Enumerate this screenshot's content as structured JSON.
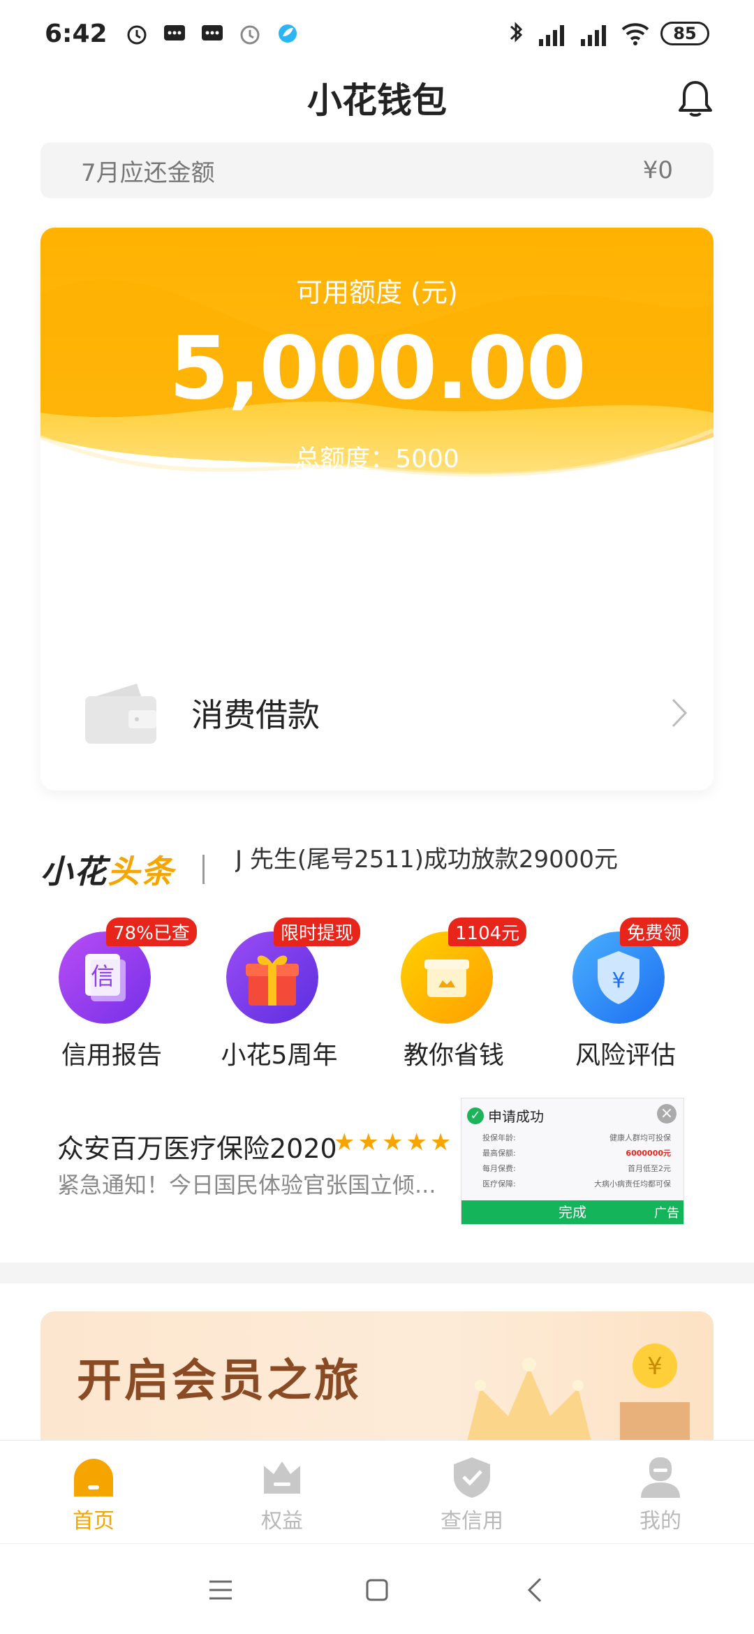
{
  "status_bar": {
    "time": "6:42",
    "battery": "85"
  },
  "header": {
    "title": "小花钱包"
  },
  "repay": {
    "label": "7月应还金额",
    "amount": "¥0"
  },
  "credit": {
    "available_label": "可用额度 (元)",
    "available_value": "5,000.00",
    "total_label": "总额度：5000"
  },
  "loan": {
    "label": "消费借款"
  },
  "news": {
    "logo_main": "小花",
    "logo_accent": "头条",
    "headline": "J 先生(尾号2511)成功放款29000元"
  },
  "quick_entries": [
    {
      "label": "信用报告",
      "badge": "78%已查",
      "color": "#8e3df0"
    },
    {
      "label": "小花5周年",
      "badge": "限时提现",
      "color": "#7a3df0"
    },
    {
      "label": "教你省钱",
      "badge": "1104元",
      "color": "#f8b300"
    },
    {
      "label": "风险评估",
      "badge": "免费领",
      "color": "#2d8cf0"
    }
  ],
  "ad": {
    "title": "众安百万医疗保险2020",
    "stars": "★★★★★",
    "subtitle": "紧急通知！今日国民体验官张国立倾...",
    "image": {
      "status": "申请成功",
      "rows": [
        {
          "k": "投保年龄:",
          "v": "健康人群均可投保"
        },
        {
          "k": "最高保额:",
          "v": "6000000元"
        },
        {
          "k": "每月保费:",
          "v": "首月低至2元"
        },
        {
          "k": "医疗保障:",
          "v": "大病小病责任均都可保"
        }
      ],
      "button": "完成",
      "tag": "广告"
    }
  },
  "member": {
    "title": "开启会员之旅"
  },
  "tabbar": {
    "items": [
      {
        "label": "首页",
        "active": true
      },
      {
        "label": "权益",
        "active": false
      },
      {
        "label": "查信用",
        "active": false
      },
      {
        "label": "我的",
        "active": false
      }
    ]
  },
  "colors": {
    "accent": "#f6a500",
    "gold_top": "#ffb300",
    "badge_red": "#e8251b"
  }
}
